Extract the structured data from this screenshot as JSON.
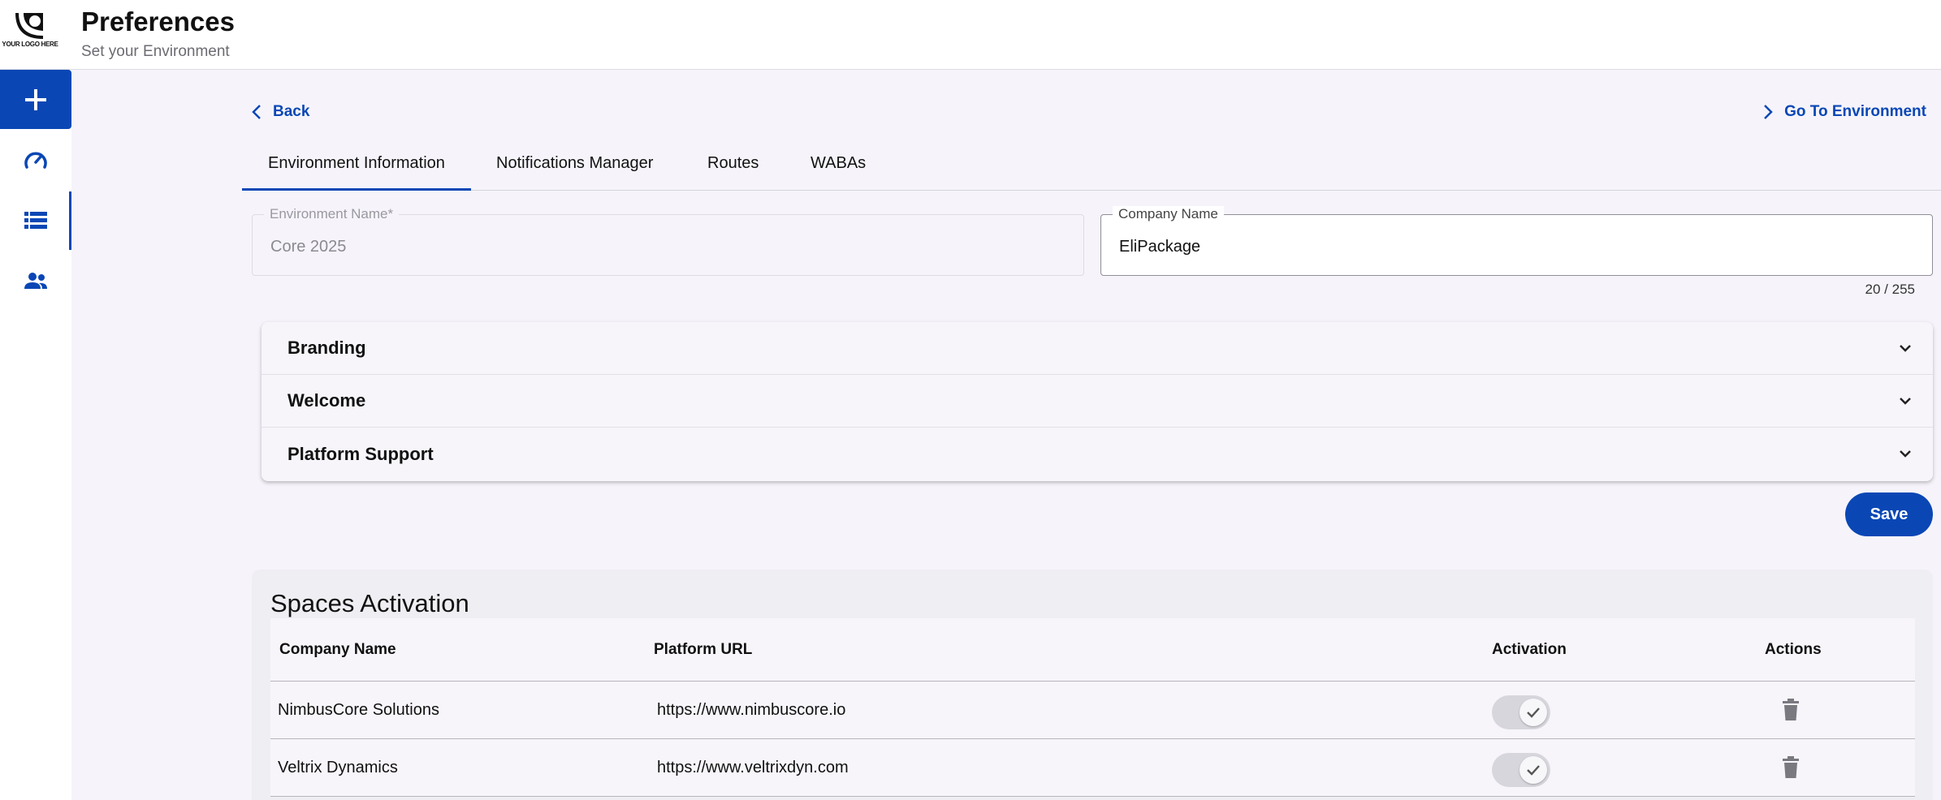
{
  "header": {
    "logo_text": "YOUR LOGO HERE",
    "title": "Preferences",
    "subtitle": "Set your Environment"
  },
  "sidebar": {
    "items": [
      {
        "icon": "plus-icon",
        "active": false
      },
      {
        "icon": "dashboard-gauge-icon",
        "active": false
      },
      {
        "icon": "list-icon",
        "active": true
      },
      {
        "icon": "users-icon",
        "active": false
      }
    ]
  },
  "nav": {
    "back_label": "Back",
    "go_label": "Go To Environment"
  },
  "tabs": [
    {
      "label": "Environment Information",
      "active": true
    },
    {
      "label": "Notifications Manager",
      "active": false
    },
    {
      "label": "Routes",
      "active": false
    },
    {
      "label": "WABAs",
      "active": false
    }
  ],
  "form": {
    "env_name_label": "Environment Name*",
    "env_name_value": "Core 2025",
    "company_name_label": "Company Name",
    "company_name_value": "EliPackage",
    "counter": "20 / 255"
  },
  "accordion": [
    {
      "title": "Branding"
    },
    {
      "title": "Welcome"
    },
    {
      "title": "Platform Support"
    }
  ],
  "save_label": "Save",
  "spaces": {
    "title": "Spaces Activation",
    "columns": [
      "Company Name",
      "Platform URL",
      "Activation",
      "Actions"
    ],
    "rows": [
      {
        "company": "NimbusCore Solutions",
        "url": "https://www.nimbuscore.io",
        "active": true
      },
      {
        "company": "Veltrix Dynamics",
        "url": "https://www.veltrixdyn.com",
        "active": true
      }
    ]
  },
  "colors": {
    "primary": "#0a47b5",
    "background": "#f6f4fa"
  }
}
